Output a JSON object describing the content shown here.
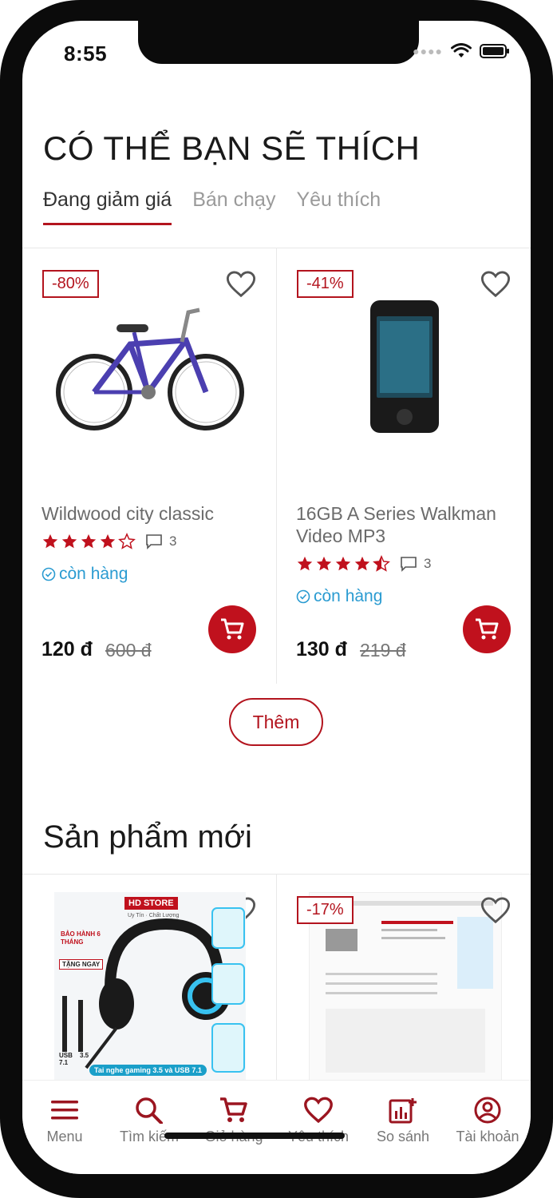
{
  "status_bar": {
    "time": "8:55"
  },
  "section": {
    "title": "CÓ THỂ BẠN SẼ THÍCH",
    "tabs": [
      {
        "label": "Đang giảm giá",
        "active": true
      },
      {
        "label": "Bán chạy",
        "active": false
      },
      {
        "label": "Yêu thích",
        "active": false
      }
    ]
  },
  "products": [
    {
      "discount": "-80%",
      "name": "Wildwood city classic",
      "rating": 4,
      "reviews": "3",
      "stock": "còn hàng",
      "price": "120 đ",
      "old_price": "600 đ",
      "image": "bicycle"
    },
    {
      "discount": "-41%",
      "name": "16GB A Series Walkman Video MP3",
      "rating": 4.5,
      "reviews": "3",
      "stock": "còn hàng",
      "price": "130 đ",
      "old_price": "219 đ",
      "image": "walkman"
    }
  ],
  "more_button": "Thêm",
  "new_products": {
    "title": "Sản phẩm mới",
    "items": [
      {
        "discount": "",
        "image": "gaming-headset",
        "brand": "HD STORE",
        "tagline": "Uy Tín · Chất Lượng",
        "warranty": "BẢO HÀNH 6 THÁNG",
        "gift": "TẶNG NGAY",
        "caption": "Tai nghe gaming 3.5 và USB 7.1",
        "labels": [
          "USB 7.1",
          "3.5"
        ]
      },
      {
        "discount": "-17%",
        "image": "webpage-screenshot"
      }
    ]
  },
  "bottom_nav": [
    {
      "label": "Menu",
      "icon": "menu-icon"
    },
    {
      "label": "Tìm kiếm",
      "icon": "search-icon"
    },
    {
      "label": "Giỏ hàng",
      "icon": "cart-icon"
    },
    {
      "label": "Yêu thích",
      "icon": "heart-icon"
    },
    {
      "label": "So sánh",
      "icon": "compare-icon"
    },
    {
      "label": "Tài khoản",
      "icon": "account-icon"
    }
  ],
  "colors": {
    "accent": "#b3141e",
    "stock": "#2a9bd1",
    "text": "#1a1a1a"
  }
}
